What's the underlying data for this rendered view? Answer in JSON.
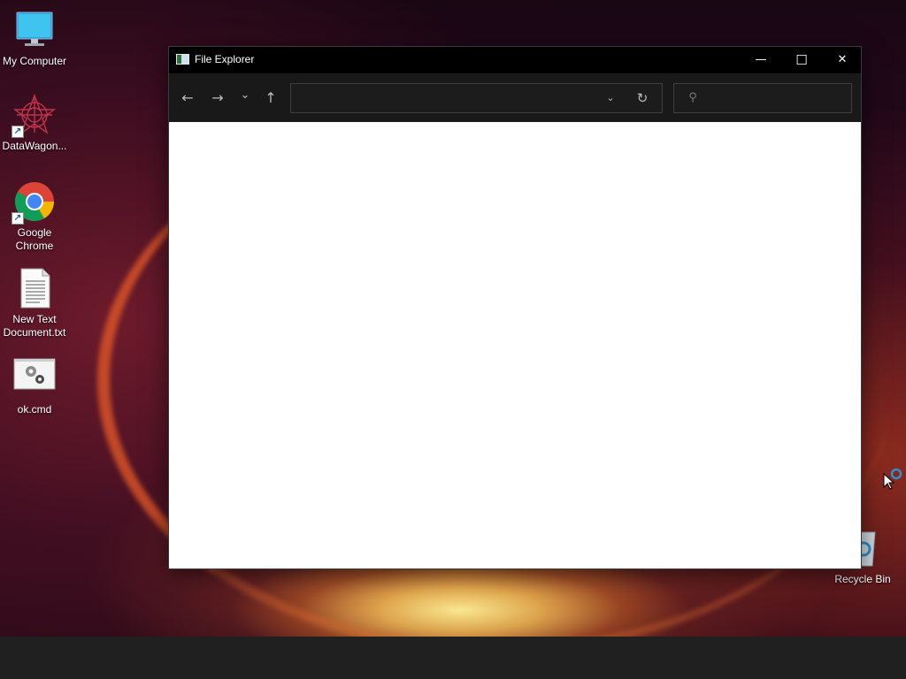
{
  "desktop": {
    "icons": [
      {
        "label": "My Computer",
        "icon": "monitor-icon"
      },
      {
        "label": "DataWagon...",
        "icon": "datawagon-icon"
      },
      {
        "label": "Google Chrome",
        "icon": "chrome-icon"
      },
      {
        "label": "New Text Document.txt",
        "icon": "text-document-icon"
      },
      {
        "label": "ok.cmd",
        "icon": "cmd-script-icon"
      },
      {
        "label": "Recycle Bin",
        "icon": "recycle-bin-icon"
      }
    ]
  },
  "explorer": {
    "title": "File Explorer",
    "caption": {
      "minimize": "—",
      "maximize": "☐",
      "close": "✕"
    },
    "nav": {
      "back": "←",
      "forward": "→",
      "recent": "⌄",
      "up": "↑"
    },
    "address": {
      "value": "",
      "dropdown": "⌄",
      "refresh": "↻"
    },
    "search": {
      "value": "",
      "placeholder": "",
      "icon": "⚲"
    }
  },
  "colors": {
    "titlebar": "#000000",
    "toolbar": "#191919",
    "taskbar": "#202020",
    "content": "#ffffff"
  }
}
